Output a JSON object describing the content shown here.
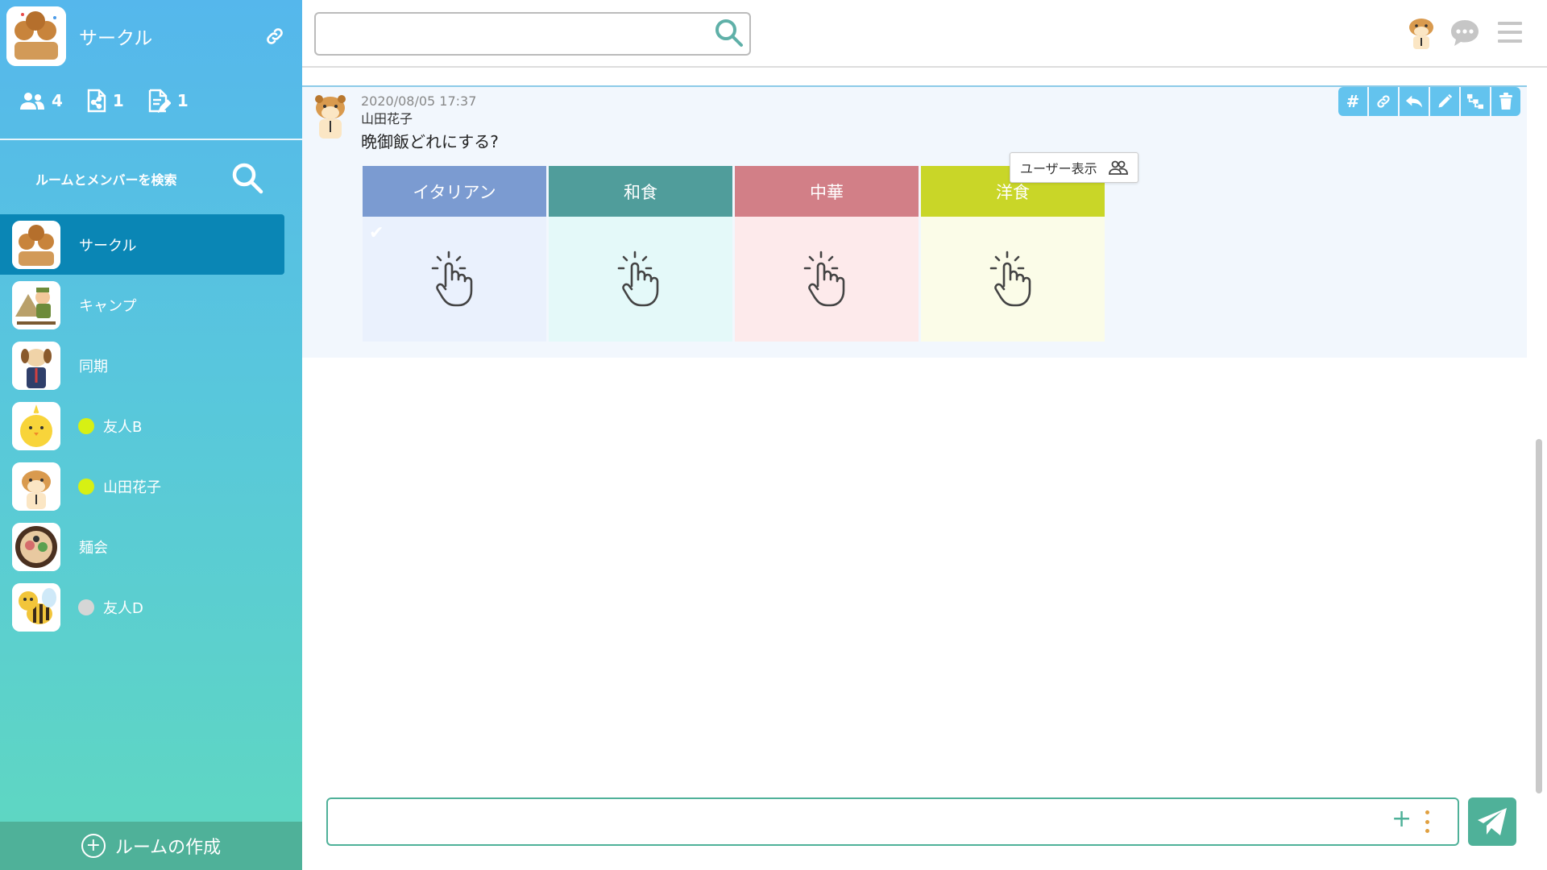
{
  "sidebar": {
    "title": "サークル",
    "stats": {
      "members": "4",
      "files": "1",
      "notes": "1"
    },
    "search_label": "ルームとメンバーを検索",
    "rooms": [
      {
        "label": "サークル",
        "avatar": "circle-avatar"
      },
      {
        "label": "キャンプ",
        "avatar": "camp-avatar"
      },
      {
        "label": "同期",
        "avatar": "dog-avatar"
      },
      {
        "label": "友人B",
        "avatar": "chick-avatar",
        "status_color": "#d7f013"
      },
      {
        "label": "山田花子",
        "avatar": "hamster-avatar",
        "status_color": "#d7f013"
      },
      {
        "label": "麺会",
        "avatar": "ramen-avatar"
      },
      {
        "label": "友人D",
        "avatar": "bee-avatar",
        "status_color": "#d6d6d6"
      }
    ],
    "create_room": "ルームの作成"
  },
  "topbar": {
    "search_value": ""
  },
  "message": {
    "timestamp": "2020/08/05 17:37",
    "author": "山田花子",
    "text": "晩御飯どれにする?",
    "actions": [
      "hash-icon",
      "link-icon",
      "reply-icon",
      "edit-icon",
      "thread-icon",
      "trash-icon"
    ],
    "poll": {
      "options": [
        {
          "label": "イタリアン",
          "head_color": "#7b9bd1",
          "body_color": "#eaf1fd",
          "checked": true
        },
        {
          "label": "和食",
          "head_color": "#509d9b",
          "body_color": "#e4f9f9"
        },
        {
          "label": "中華",
          "head_color": "#d27f87",
          "body_color": "#fdeaeb"
        },
        {
          "label": "洋食",
          "head_color": "#c9d628",
          "body_color": "#fbfce8"
        }
      ]
    },
    "tooltip": "ユーザー表示"
  },
  "composer": {
    "value": ""
  }
}
